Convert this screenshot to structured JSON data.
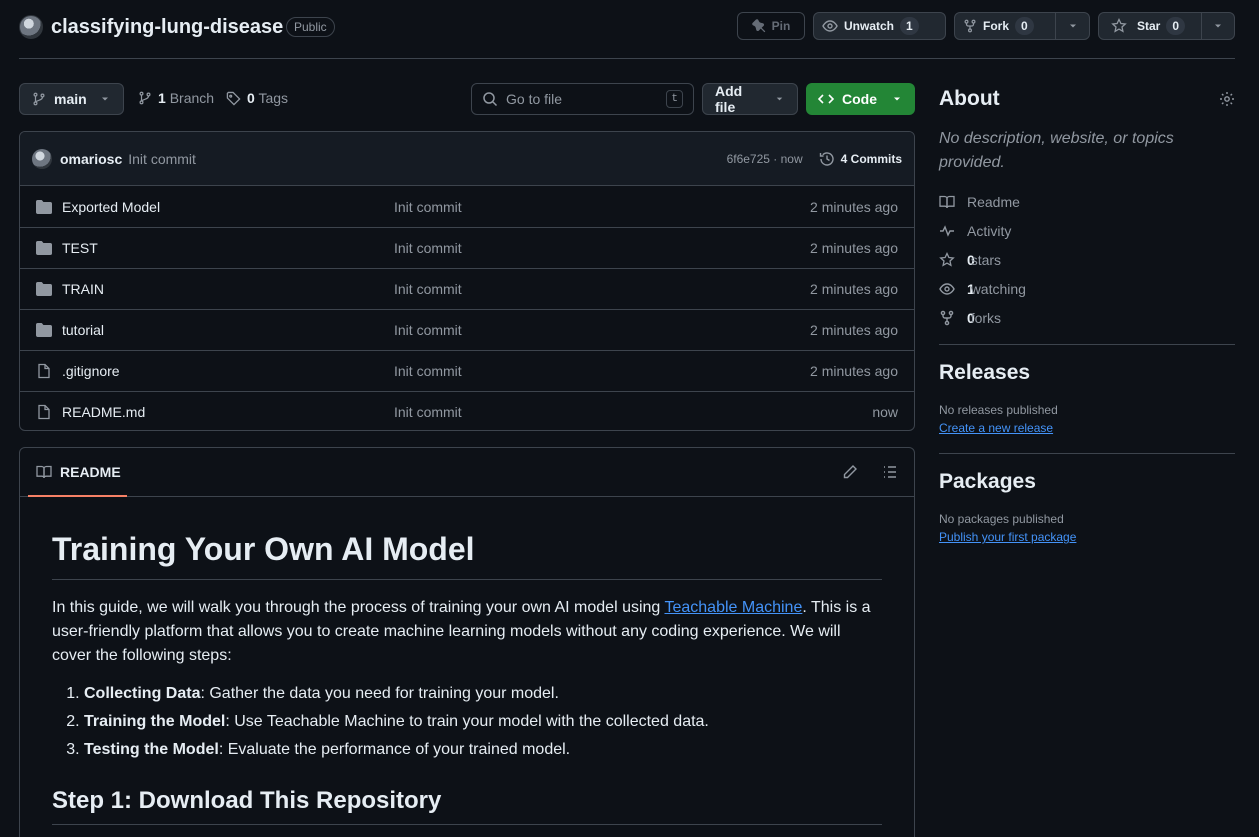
{
  "repo": {
    "name": "classifying-lung-disease",
    "visibility": "Public"
  },
  "actions": {
    "pin_label": "Pin",
    "unwatch_label": "Unwatch",
    "unwatch_count": "1",
    "fork_label": "Fork",
    "fork_count": "0",
    "star_label": "Star",
    "star_count": "0"
  },
  "toolbar": {
    "branch": "main",
    "branch_count": "1",
    "branch_label": "Branch",
    "tag_count": "0",
    "tag_label": "Tags",
    "search_placeholder": "Go to file",
    "search_shortcut": "t",
    "add_file_label": "Add file",
    "code_label": "Code"
  },
  "latest_commit": {
    "user": "omariosc",
    "message": "Init commit",
    "hash_time": "6f6e725 · now",
    "commits_label": "4 Commits"
  },
  "files": [
    {
      "name": "Exported Model",
      "type": "folder",
      "message": "Init commit",
      "age": "2 minutes ago"
    },
    {
      "name": "TEST",
      "type": "folder",
      "message": "Init commit",
      "age": "2 minutes ago"
    },
    {
      "name": "TRAIN",
      "type": "folder",
      "message": "Init commit",
      "age": "2 minutes ago"
    },
    {
      "name": "tutorial",
      "type": "folder",
      "message": "Init commit",
      "age": "2 minutes ago"
    },
    {
      "name": ".gitignore",
      "type": "file",
      "message": "Init commit",
      "age": "2 minutes ago"
    },
    {
      "name": "README.md",
      "type": "file",
      "message": "Init commit",
      "age": "now"
    }
  ],
  "readme": {
    "tab_label": "README",
    "title": "Training Your Own AI Model",
    "intro_before": "In this guide, we will walk you through the process of training your own AI model using ",
    "intro_link": "Teachable Machine",
    "intro_after": ". This is a user-friendly platform that allows you to create machine learning models without any coding experience. We will cover the following steps:",
    "steps": [
      {
        "bold": "Collecting Data",
        "text": ": Gather the data you need for training your model."
      },
      {
        "bold": "Training the Model",
        "text": ": Use Teachable Machine to train your model with the collected data."
      },
      {
        "bold": "Testing the Model",
        "text": ": Evaluate the performance of your trained model."
      }
    ],
    "step1_heading": "Step 1: Download This Repository"
  },
  "about": {
    "heading": "About",
    "description": "No description, website, or topics provided.",
    "readme_label": "Readme",
    "activity_label": "Activity",
    "stars_count": "0",
    "stars_label": "stars",
    "watching_count": "1",
    "watching_label": "watching",
    "forks_count": "0",
    "forks_label": "forks"
  },
  "releases": {
    "heading": "Releases",
    "empty_text": "No releases published",
    "link": "Create a new release"
  },
  "packages": {
    "heading": "Packages",
    "empty_text": "No packages published",
    "link": "Publish your first package"
  },
  "colors": {
    "background": "#0d1117",
    "accent_green": "#238636",
    "link_blue": "#4493f8",
    "tab_underline": "#f78166"
  }
}
